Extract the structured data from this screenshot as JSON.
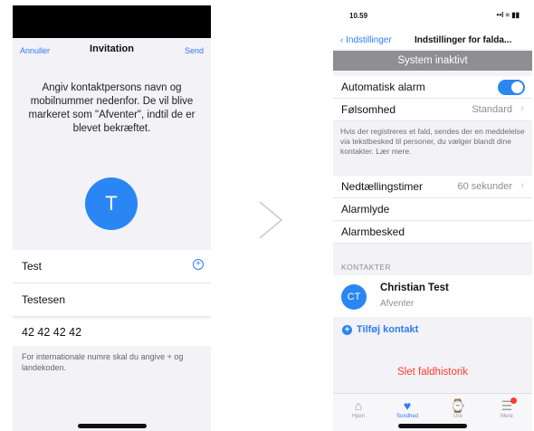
{
  "left": {
    "nav": {
      "cancel": "Annuller",
      "title": "Invitation",
      "send": "Send"
    },
    "explanation": "Angiv kontaktpersons navn og mobilnummer nedenfor. De vil blive markeret som \"Afventer\", indtil de er blevet bekræftet.",
    "avatar_initial": "T",
    "first_name": "Test",
    "last_name": "Testesen",
    "phone": "42 42 42 42",
    "phone_hint": "For internationale numre skal du angive + og landekoden."
  },
  "right": {
    "status": {
      "time": "10.59",
      "icons": "••l ≈ ▮▮"
    },
    "nav": {
      "back": "Indstillinger",
      "title": "Indstillinger for falda..."
    },
    "banner": "System inaktivt",
    "auto_alarm": {
      "label": "Automatisk alarm",
      "on": true
    },
    "sensitivity": {
      "label": "Følsomhed",
      "value": "Standard"
    },
    "description": "Hvis der registreres et fald, sendes der en meddelelse via tekstbesked til personer, du vælger blandt dine kontakter. Lær mere.",
    "countdown": {
      "label": "Nedtællingstimer",
      "value": "60 sekunder"
    },
    "alarm_sounds": "Alarmlyde",
    "alarm_message": "Alarmbesked",
    "contacts_header": "KONTAKTER",
    "contact": {
      "initials": "CT",
      "name": "Christian Test",
      "status": "Afventer"
    },
    "add_contact": "Tilføj kontakt",
    "delete_history": "Slet faldhistorik",
    "tabs": [
      {
        "label": "Hjem"
      },
      {
        "label": "Sundhed"
      },
      {
        "label": "Ure"
      },
      {
        "label": "Mere"
      }
    ]
  },
  "colors": {
    "accent": "#2a86f3",
    "destructive": "#ff3b30",
    "banner": "#8e8e93"
  }
}
